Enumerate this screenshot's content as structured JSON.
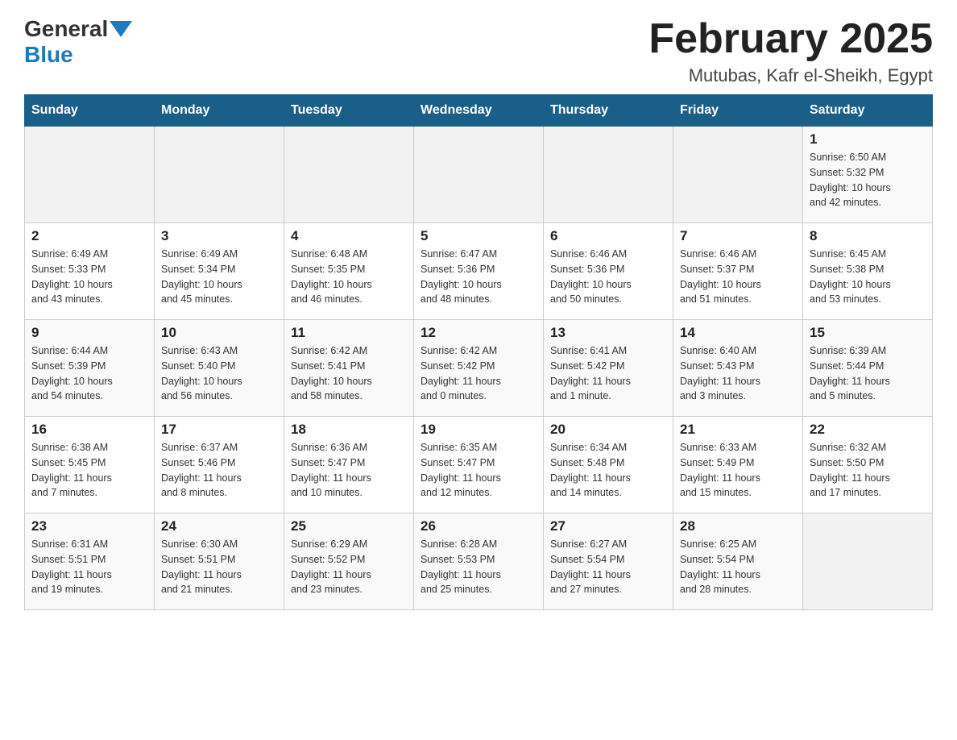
{
  "header": {
    "logo_general": "General",
    "logo_blue": "Blue",
    "month_title": "February 2025",
    "location": "Mutubas, Kafr el-Sheikh, Egypt"
  },
  "days_of_week": [
    "Sunday",
    "Monday",
    "Tuesday",
    "Wednesday",
    "Thursday",
    "Friday",
    "Saturday"
  ],
  "weeks": [
    [
      {
        "day": "",
        "info": ""
      },
      {
        "day": "",
        "info": ""
      },
      {
        "day": "",
        "info": ""
      },
      {
        "day": "",
        "info": ""
      },
      {
        "day": "",
        "info": ""
      },
      {
        "day": "",
        "info": ""
      },
      {
        "day": "1",
        "info": "Sunrise: 6:50 AM\nSunset: 5:32 PM\nDaylight: 10 hours\nand 42 minutes."
      }
    ],
    [
      {
        "day": "2",
        "info": "Sunrise: 6:49 AM\nSunset: 5:33 PM\nDaylight: 10 hours\nand 43 minutes."
      },
      {
        "day": "3",
        "info": "Sunrise: 6:49 AM\nSunset: 5:34 PM\nDaylight: 10 hours\nand 45 minutes."
      },
      {
        "day": "4",
        "info": "Sunrise: 6:48 AM\nSunset: 5:35 PM\nDaylight: 10 hours\nand 46 minutes."
      },
      {
        "day": "5",
        "info": "Sunrise: 6:47 AM\nSunset: 5:36 PM\nDaylight: 10 hours\nand 48 minutes."
      },
      {
        "day": "6",
        "info": "Sunrise: 6:46 AM\nSunset: 5:36 PM\nDaylight: 10 hours\nand 50 minutes."
      },
      {
        "day": "7",
        "info": "Sunrise: 6:46 AM\nSunset: 5:37 PM\nDaylight: 10 hours\nand 51 minutes."
      },
      {
        "day": "8",
        "info": "Sunrise: 6:45 AM\nSunset: 5:38 PM\nDaylight: 10 hours\nand 53 minutes."
      }
    ],
    [
      {
        "day": "9",
        "info": "Sunrise: 6:44 AM\nSunset: 5:39 PM\nDaylight: 10 hours\nand 54 minutes."
      },
      {
        "day": "10",
        "info": "Sunrise: 6:43 AM\nSunset: 5:40 PM\nDaylight: 10 hours\nand 56 minutes."
      },
      {
        "day": "11",
        "info": "Sunrise: 6:42 AM\nSunset: 5:41 PM\nDaylight: 10 hours\nand 58 minutes."
      },
      {
        "day": "12",
        "info": "Sunrise: 6:42 AM\nSunset: 5:42 PM\nDaylight: 11 hours\nand 0 minutes."
      },
      {
        "day": "13",
        "info": "Sunrise: 6:41 AM\nSunset: 5:42 PM\nDaylight: 11 hours\nand 1 minute."
      },
      {
        "day": "14",
        "info": "Sunrise: 6:40 AM\nSunset: 5:43 PM\nDaylight: 11 hours\nand 3 minutes."
      },
      {
        "day": "15",
        "info": "Sunrise: 6:39 AM\nSunset: 5:44 PM\nDaylight: 11 hours\nand 5 minutes."
      }
    ],
    [
      {
        "day": "16",
        "info": "Sunrise: 6:38 AM\nSunset: 5:45 PM\nDaylight: 11 hours\nand 7 minutes."
      },
      {
        "day": "17",
        "info": "Sunrise: 6:37 AM\nSunset: 5:46 PM\nDaylight: 11 hours\nand 8 minutes."
      },
      {
        "day": "18",
        "info": "Sunrise: 6:36 AM\nSunset: 5:47 PM\nDaylight: 11 hours\nand 10 minutes."
      },
      {
        "day": "19",
        "info": "Sunrise: 6:35 AM\nSunset: 5:47 PM\nDaylight: 11 hours\nand 12 minutes."
      },
      {
        "day": "20",
        "info": "Sunrise: 6:34 AM\nSunset: 5:48 PM\nDaylight: 11 hours\nand 14 minutes."
      },
      {
        "day": "21",
        "info": "Sunrise: 6:33 AM\nSunset: 5:49 PM\nDaylight: 11 hours\nand 15 minutes."
      },
      {
        "day": "22",
        "info": "Sunrise: 6:32 AM\nSunset: 5:50 PM\nDaylight: 11 hours\nand 17 minutes."
      }
    ],
    [
      {
        "day": "23",
        "info": "Sunrise: 6:31 AM\nSunset: 5:51 PM\nDaylight: 11 hours\nand 19 minutes."
      },
      {
        "day": "24",
        "info": "Sunrise: 6:30 AM\nSunset: 5:51 PM\nDaylight: 11 hours\nand 21 minutes."
      },
      {
        "day": "25",
        "info": "Sunrise: 6:29 AM\nSunset: 5:52 PM\nDaylight: 11 hours\nand 23 minutes."
      },
      {
        "day": "26",
        "info": "Sunrise: 6:28 AM\nSunset: 5:53 PM\nDaylight: 11 hours\nand 25 minutes."
      },
      {
        "day": "27",
        "info": "Sunrise: 6:27 AM\nSunset: 5:54 PM\nDaylight: 11 hours\nand 27 minutes."
      },
      {
        "day": "28",
        "info": "Sunrise: 6:25 AM\nSunset: 5:54 PM\nDaylight: 11 hours\nand 28 minutes."
      },
      {
        "day": "",
        "info": ""
      }
    ]
  ]
}
